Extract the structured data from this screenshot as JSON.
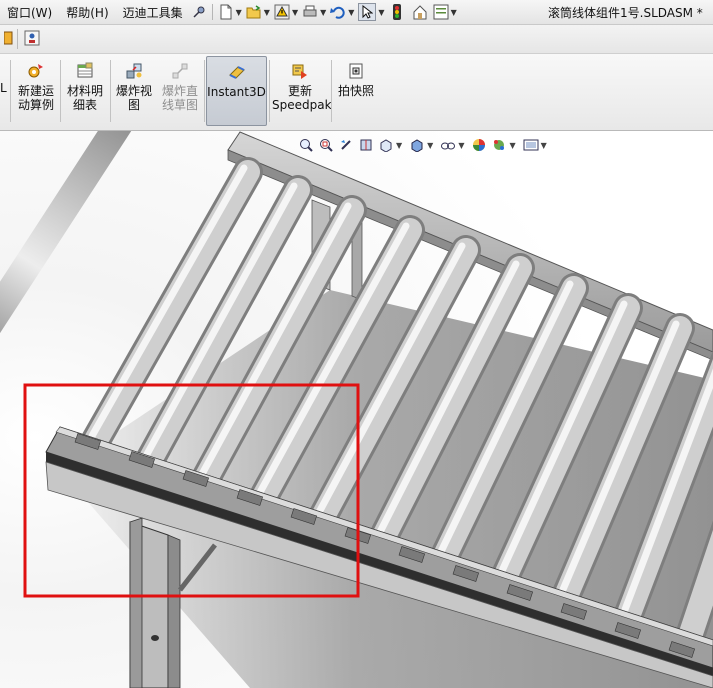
{
  "menu": {
    "items": [
      "窗口(W)",
      "帮助(H)",
      "迈迪工具集"
    ]
  },
  "document_title": "滚筒线体组件1号.SLDASM *",
  "command_manager": {
    "tools": [
      {
        "label_line1": "新建运",
        "label_line2": "动算例",
        "icon": "new-motion-study-icon",
        "enabled": true
      },
      {
        "label_line1": "材料明",
        "label_line2": "细表",
        "icon": "bill-of-materials-icon",
        "enabled": true
      },
      {
        "label_line1": "爆炸视",
        "label_line2": "图",
        "icon": "exploded-view-icon",
        "enabled": true
      },
      {
        "label_line1": "爆炸直",
        "label_line2": "线草图",
        "icon": "explode-line-sketch-icon",
        "enabled": false
      },
      {
        "label_line1": "Instant3D",
        "label_line2": "",
        "icon": "instant3d-icon",
        "enabled": true,
        "active": true
      },
      {
        "label_line1": "更新",
        "label_line2": "Speedpak",
        "icon": "update-speedpak-icon",
        "enabled": true
      },
      {
        "label_line1": "拍快照",
        "label_line2": "",
        "icon": "snapshot-icon",
        "enabled": true
      }
    ],
    "left_partial_label": "L"
  },
  "colors": {
    "highlight_box": "#e01010",
    "roller": "#b4b4b4",
    "frame": "#8a8a8a",
    "background_top": "#ffffff",
    "background_shadow": "#8c8c8c"
  }
}
